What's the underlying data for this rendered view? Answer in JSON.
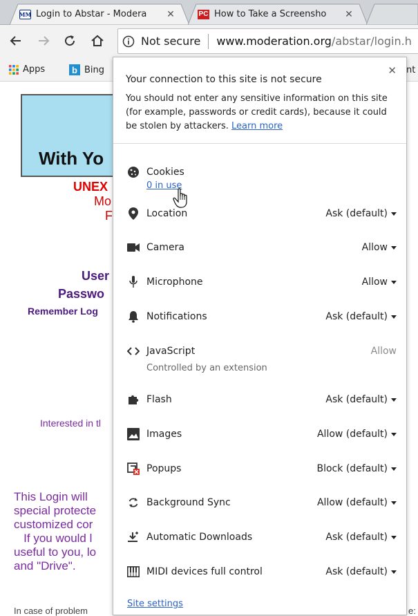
{
  "tabs": [
    {
      "title": "Login to Abstar - Modera",
      "favicon": "moderation-favicon",
      "active": true
    },
    {
      "title": "How to Take a Screensho",
      "favicon": "pc-favicon",
      "active": false
    }
  ],
  "address_bar": {
    "security_label": "Not secure",
    "url_host": "www.moderation.org",
    "url_path": "/abstar/login.h"
  },
  "bookmarks": [
    {
      "label": "Apps",
      "icon": "apps-grid-icon"
    },
    {
      "label": "Bing",
      "icon": "bing-icon"
    }
  ],
  "bookmarks_extra": "nt",
  "background_page": {
    "banner_text": "With Yo",
    "unexpected": "UNEX",
    "mo": "Mo",
    "p": "F",
    "user": "User",
    "password": "Passwo",
    "remember": "Remember Log",
    "interested": "Interested in tl",
    "login_para": [
      "This Login will",
      "special protecte",
      "customized cor",
      "   If you would l",
      "useful to you, lo",
      "and \"Drive\"."
    ],
    "in_case": "In case of problem",
    "right_clip": "e:"
  },
  "popup": {
    "title": "Your connection to this site is not secure",
    "description": "You should not enter any sensitive information on this site (for example, passwords or credit cards), because it could be stolen by attackers.",
    "learn_more": "Learn more",
    "cookies_label": "Cookies",
    "cookies_in_use": "0 in use",
    "permissions": [
      {
        "label": "Location",
        "value": "Ask (default)",
        "icon": "location-pin-icon"
      },
      {
        "label": "Camera",
        "value": "Allow",
        "icon": "camera-icon"
      },
      {
        "label": "Microphone",
        "value": "Allow",
        "icon": "microphone-icon"
      },
      {
        "label": "Notifications",
        "value": "Ask (default)",
        "icon": "bell-icon"
      },
      {
        "label": "JavaScript",
        "value": "Allow",
        "icon": "code-icon"
      },
      {
        "label": "Flash",
        "value": "Ask (default)",
        "icon": "puzzle-icon"
      },
      {
        "label": "Images",
        "value": "Allow (default)",
        "icon": "image-icon"
      },
      {
        "label": "Popups",
        "value": "Block (default)",
        "icon": "popup-blocked-icon"
      },
      {
        "label": "Background Sync",
        "value": "Allow (default)",
        "icon": "sync-icon"
      },
      {
        "label": "Automatic Downloads",
        "value": "Ask (default)",
        "icon": "download-icon"
      },
      {
        "label": "MIDI devices full control",
        "value": "Ask (default)",
        "icon": "midi-icon"
      }
    ],
    "javascript_note": "Controlled by an extension",
    "site_settings": "Site settings"
  },
  "colors": {
    "link": "#2a62c8",
    "banner": "#a9def0",
    "warning_red": "#e00000",
    "purple_text": "#7a2a9e"
  }
}
